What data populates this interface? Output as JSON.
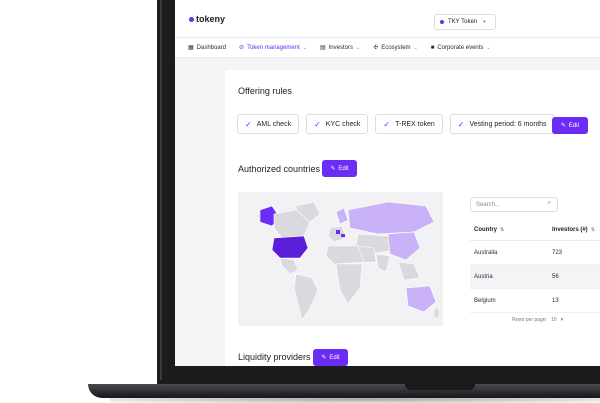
{
  "app": {
    "logo_text": "tokeny",
    "token_selector": "TKY Token"
  },
  "nav": {
    "items": [
      {
        "label": "Dashboard",
        "icon": "dashboard-icon"
      },
      {
        "label": "Token management",
        "icon": "check-circle-icon",
        "active": true
      },
      {
        "label": "Investors",
        "icon": "id-card-icon"
      },
      {
        "label": "Ecosystem",
        "icon": "globe-icon"
      },
      {
        "label": "Corporate events",
        "icon": "briefcase-icon"
      }
    ]
  },
  "offering_rules": {
    "title": "Offering rules",
    "rules": [
      "AML check",
      "KYC check",
      "T-REX token",
      "Vesting period: 6 months"
    ],
    "edit_label": "Edit"
  },
  "authorized_countries": {
    "title": "Authorized countries",
    "edit_label": "Edit",
    "search_placeholder": "Search...",
    "columns": [
      "Country",
      "Investors (#)"
    ],
    "rows": [
      {
        "country": "Australia",
        "investors": "723"
      },
      {
        "country": "Austria",
        "investors": "56"
      },
      {
        "country": "Belgium",
        "investors": "13"
      }
    ],
    "rows_per_page_label": "Rows per page:",
    "rows_per_page_value": "10"
  },
  "liquidity_providers": {
    "title": "Liquidity providers",
    "edit_label": "Edit"
  },
  "colors": {
    "accent": "#6b2cf5",
    "map_highlight_light": "#c9b2f7",
    "map_base": "#d9d9de"
  }
}
